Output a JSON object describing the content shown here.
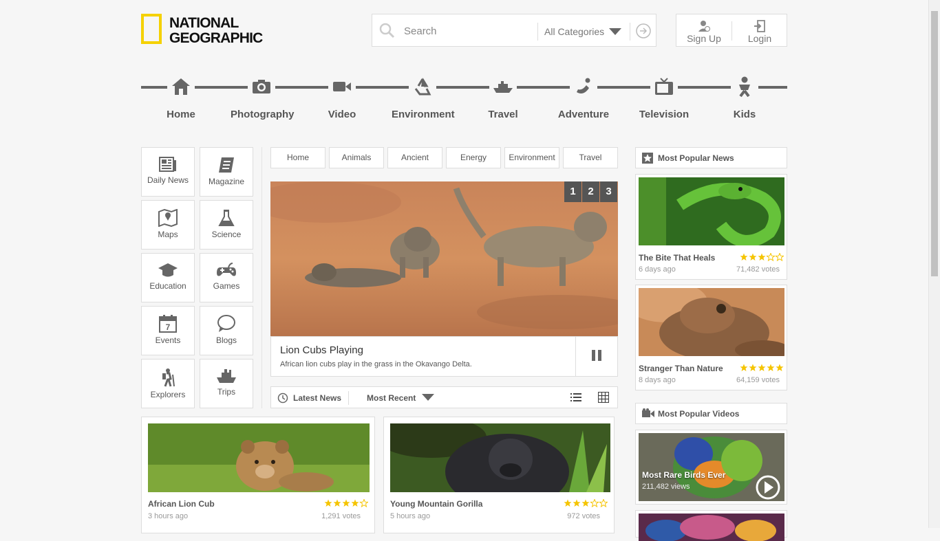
{
  "brand": {
    "logo_line1": "NATIONAL",
    "logo_line2": "GEOGRAPHIC",
    "accent": "#f5d100"
  },
  "search": {
    "placeholder": "Search",
    "category": "All Categories"
  },
  "auth": {
    "signup": "Sign Up",
    "login": "Login"
  },
  "nav": [
    "Home",
    "Photography",
    "Video",
    "Environment",
    "Travel",
    "Adventure",
    "Television",
    "Kids"
  ],
  "sections": [
    "Daily News",
    "Magazine",
    "Maps",
    "Science",
    "Education",
    "Games",
    "Events",
    "Blogs",
    "Explorers",
    "Trips"
  ],
  "events_day": "7",
  "tabs": [
    "Home",
    "Animals",
    "Ancient",
    "Energy",
    "Environment",
    "Travel"
  ],
  "hero": {
    "pages": [
      "1",
      "2",
      "3"
    ],
    "title": "Lion Cubs Playing",
    "subtitle": "African lion cubs play in the grass in the Okavango Delta."
  },
  "latest": {
    "label": "Latest News",
    "sort": "Most Recent"
  },
  "news": [
    {
      "title": "African Lion Cub",
      "time": "3 hours ago",
      "votes": "1,291 votes",
      "rating": 4
    },
    {
      "title": "Young Mountain Gorilla",
      "time": "5 hours ago",
      "votes": "972 votes",
      "rating": 3
    }
  ],
  "popular_news": {
    "heading": "Most Popular News",
    "items": [
      {
        "title": "The Bite That Heals",
        "time": "6 days ago",
        "votes": "71,482 votes",
        "rating": 3
      },
      {
        "title": "Stranger Than Nature",
        "time": "8 days ago",
        "votes": "64,159 votes",
        "rating": 5
      }
    ]
  },
  "popular_videos": {
    "heading": "Most Popular Videos",
    "items": [
      {
        "title": "Most Rare Birds Ever",
        "views": "211,482 views"
      }
    ]
  },
  "colors": {
    "star": "#f5c400",
    "icon": "#666666",
    "nav_line": "#666666"
  }
}
